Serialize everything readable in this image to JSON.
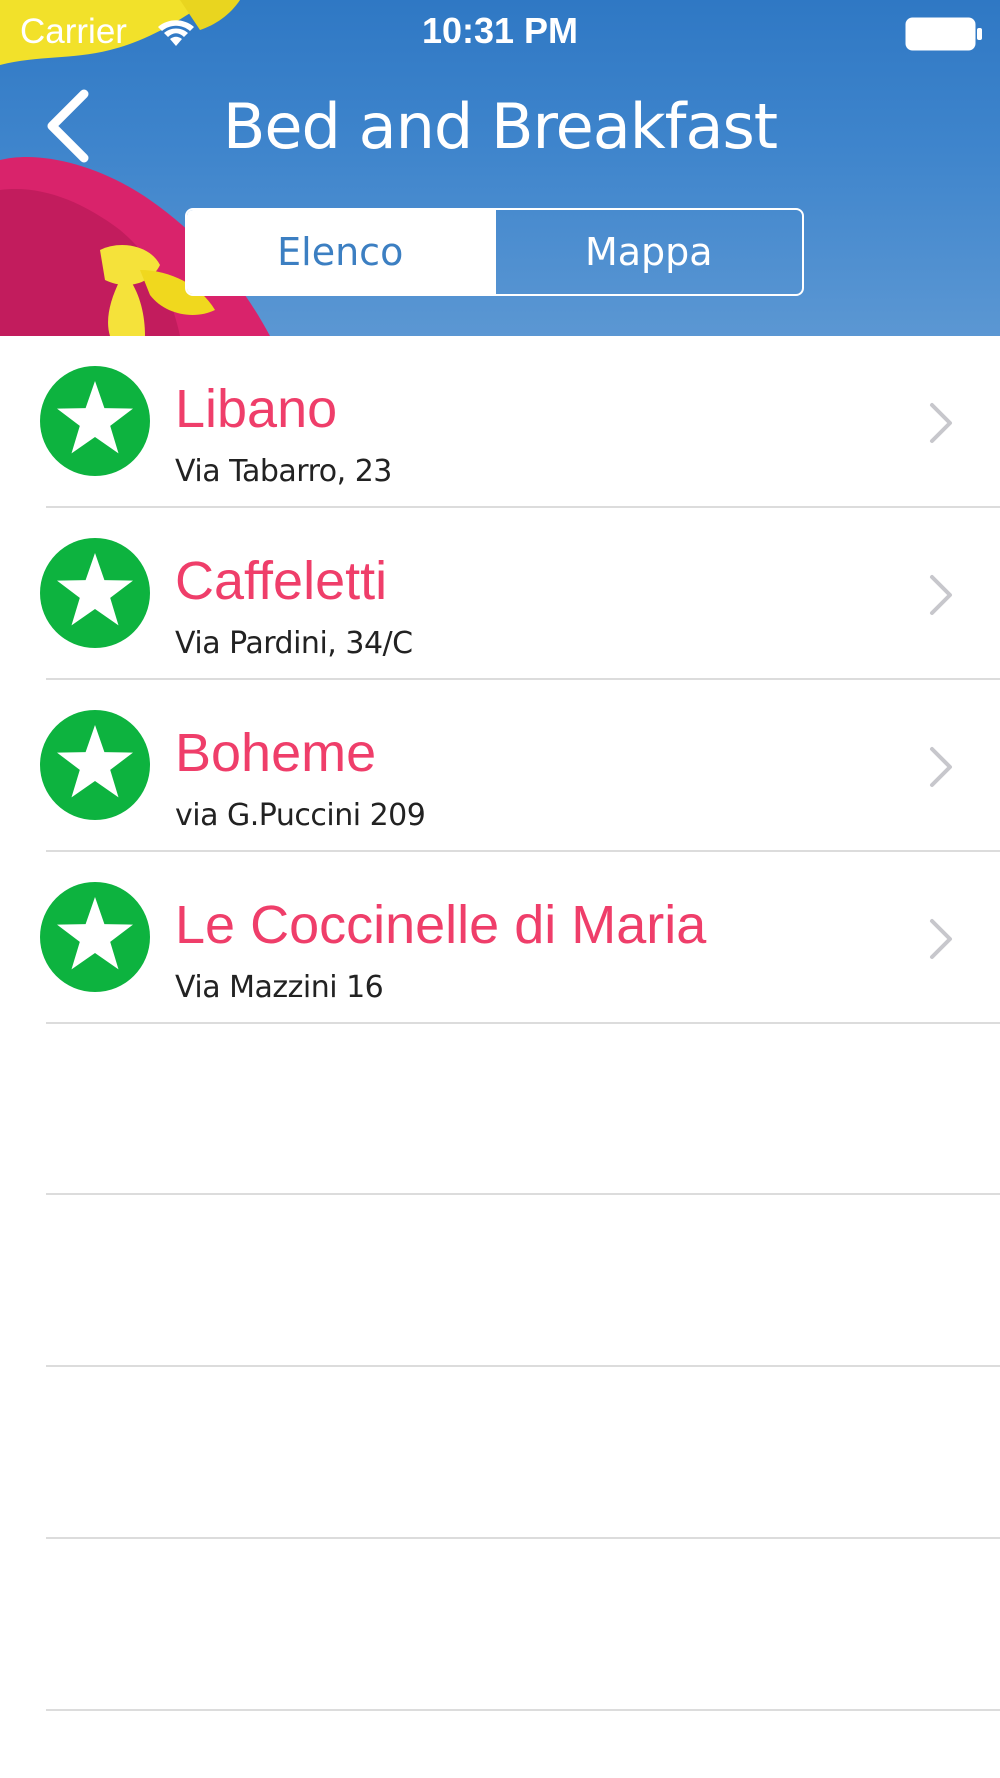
{
  "status_bar": {
    "carrier": "Carrier",
    "time": "10:31 PM",
    "wifi_icon": "wifi-icon",
    "battery_icon": "battery-icon"
  },
  "nav": {
    "title": "Bed and Breakfast",
    "back_icon": "chevron-left-icon"
  },
  "segmented_control": {
    "segments": [
      {
        "label": "Elenco",
        "selected": true
      },
      {
        "label": "Mappa",
        "selected": false
      }
    ]
  },
  "list": {
    "items": [
      {
        "title": "Libano",
        "address": "Via Tabarro, 23",
        "icon": "star-icon"
      },
      {
        "title": "Caffeletti",
        "address": "Via Pardini, 34/C",
        "icon": "star-icon"
      },
      {
        "title": "Boheme",
        "address": "via G.Puccini 209",
        "icon": "star-icon"
      },
      {
        "title": "Le Coccinelle di Maria",
        "address": "Via Mazzini 16",
        "icon": "star-icon"
      }
    ]
  },
  "colors": {
    "header_blue": "#3f85cc",
    "title_pink": "#ef3e6a",
    "star_green": "#0db33f",
    "chevron_gray": "#c7c7cc"
  }
}
